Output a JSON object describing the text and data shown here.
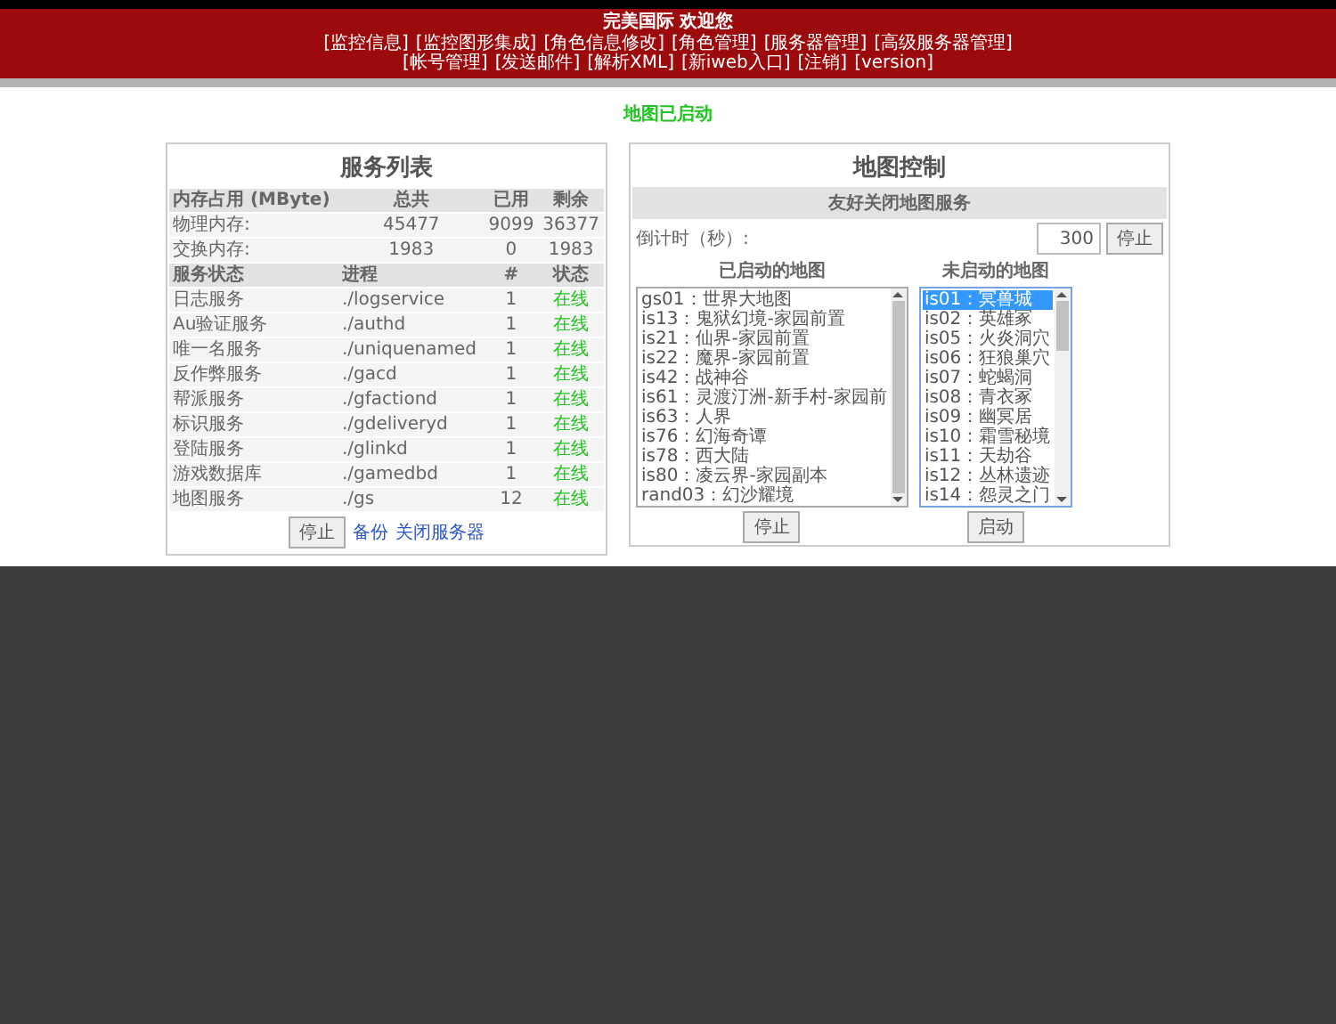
{
  "header": {
    "title": "完美国际 欢迎您",
    "nav_rows": [
      [
        "[监控信息]",
        "[监控图形集成]",
        "[角色信息修改]",
        "[角色管理]",
        "[服务器管理]",
        "[高级服务器管理]"
      ],
      [
        "[帐号管理]",
        "[发送邮件]",
        "[解析XML]",
        "[新iweb入口]",
        "[注销]",
        "[version]"
      ]
    ]
  },
  "status_message": "地图已启动",
  "services_panel": {
    "title": "服务列表",
    "memory_header": [
      "内存占用 (MByte)",
      "总共",
      "已用",
      "剩余"
    ],
    "memory_rows": [
      {
        "label": "物理内存:",
        "total": "45477",
        "used": "9099",
        "free": "36377"
      },
      {
        "label": "交换内存:",
        "total": "1983",
        "used": "0",
        "free": "1983"
      }
    ],
    "service_header": [
      "服务状态",
      "进程",
      "#",
      "状态"
    ],
    "services": [
      {
        "name": "日志服务",
        "process": "./logservice",
        "count": "1",
        "status": "在线"
      },
      {
        "name": "Au验证服务",
        "process": "./authd",
        "count": "1",
        "status": "在线"
      },
      {
        "name": "唯一名服务",
        "process": "./uniquenamed",
        "count": "1",
        "status": "在线"
      },
      {
        "name": "反作弊服务",
        "process": "./gacd",
        "count": "1",
        "status": "在线"
      },
      {
        "name": "帮派服务",
        "process": "./gfactiond",
        "count": "1",
        "status": "在线"
      },
      {
        "name": "标识服务",
        "process": "./gdeliveryd",
        "count": "1",
        "status": "在线"
      },
      {
        "name": "登陆服务",
        "process": "./glinkd",
        "count": "1",
        "status": "在线"
      },
      {
        "name": "游戏数据库",
        "process": "./gamedbd",
        "count": "1",
        "status": "在线"
      },
      {
        "name": "地图服务",
        "process": "./gs",
        "count": "12",
        "status": "在线"
      }
    ],
    "stop_button": "停止",
    "links": [
      "备份",
      "关闭服务器"
    ]
  },
  "map_panel": {
    "title": "地图控制",
    "subtitle": "友好关闭地图服务",
    "countdown": {
      "label": "倒计时（秒）:",
      "value": "300"
    },
    "stop_button": "停止",
    "started": {
      "heading": "已启动的地图",
      "button": "停止",
      "items": [
        {
          "label": "gs01：世界大地图",
          "selected": false
        },
        {
          "label": "is13：鬼狱幻境-家园前置",
          "selected": false
        },
        {
          "label": "is21：仙界-家园前置",
          "selected": false
        },
        {
          "label": "is22：魔界-家园前置",
          "selected": false
        },
        {
          "label": "is42：战神谷",
          "selected": false
        },
        {
          "label": "is61：灵渡汀洲-新手村-家园前",
          "selected": false
        },
        {
          "label": "is63：人界",
          "selected": false
        },
        {
          "label": "is76：幻海奇谭",
          "selected": false
        },
        {
          "label": "is78：西大陆",
          "selected": false
        },
        {
          "label": "is80：凌云界-家园副本",
          "selected": false
        },
        {
          "label": "rand03：幻沙耀境",
          "selected": false
        }
      ]
    },
    "stopped": {
      "heading": "未启动的地图",
      "button": "启动",
      "items": [
        {
          "label": "is01：冥兽城",
          "selected": true
        },
        {
          "label": "is02：英雄冢",
          "selected": false
        },
        {
          "label": "is05：火炎洞穴",
          "selected": false
        },
        {
          "label": "is06：狂狼巢穴",
          "selected": false
        },
        {
          "label": "is07：蛇蝎洞",
          "selected": false
        },
        {
          "label": "is08：青衣冢",
          "selected": false
        },
        {
          "label": "is09：幽冥居",
          "selected": false
        },
        {
          "label": "is10：霜雪秘境",
          "selected": false
        },
        {
          "label": "is11：天劫谷",
          "selected": false
        },
        {
          "label": "is12：丛林遗迹",
          "selected": false
        },
        {
          "label": "is14：怨灵之门",
          "selected": false
        }
      ]
    }
  }
}
